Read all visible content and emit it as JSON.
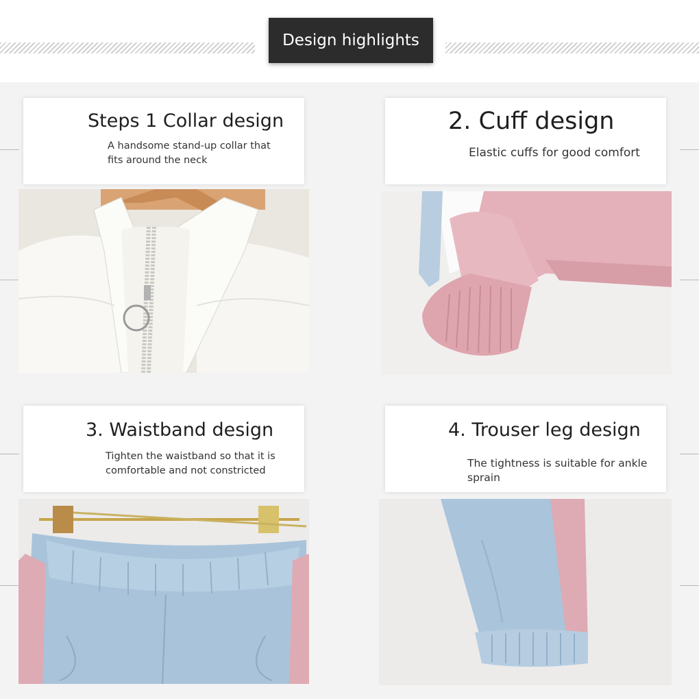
{
  "header": {
    "title": "Design highlights"
  },
  "features": [
    {
      "title": "Steps 1 Collar design",
      "description": "A handsome stand-up collar that fits around the neck",
      "image": "white-jacket-collar-photo"
    },
    {
      "title": "2. Cuff design",
      "description": "Elastic cuffs for good comfort",
      "image": "pink-sleeve-cuff-photo"
    },
    {
      "title": "3. Waistband design",
      "description": "Tighten the waistband so that it is comfortable and not constricted",
      "image": "blue-pants-waistband-photo"
    },
    {
      "title": "4. Trouser leg design",
      "description": "The tightness is suitable for ankle sprain",
      "image": "blue-trouser-leg-photo"
    }
  ],
  "colors": {
    "badge": "#2c2c2c",
    "pink": "#e0a9b3",
    "blue": "#a9c3da",
    "white_fabric": "#f8f8f4"
  }
}
